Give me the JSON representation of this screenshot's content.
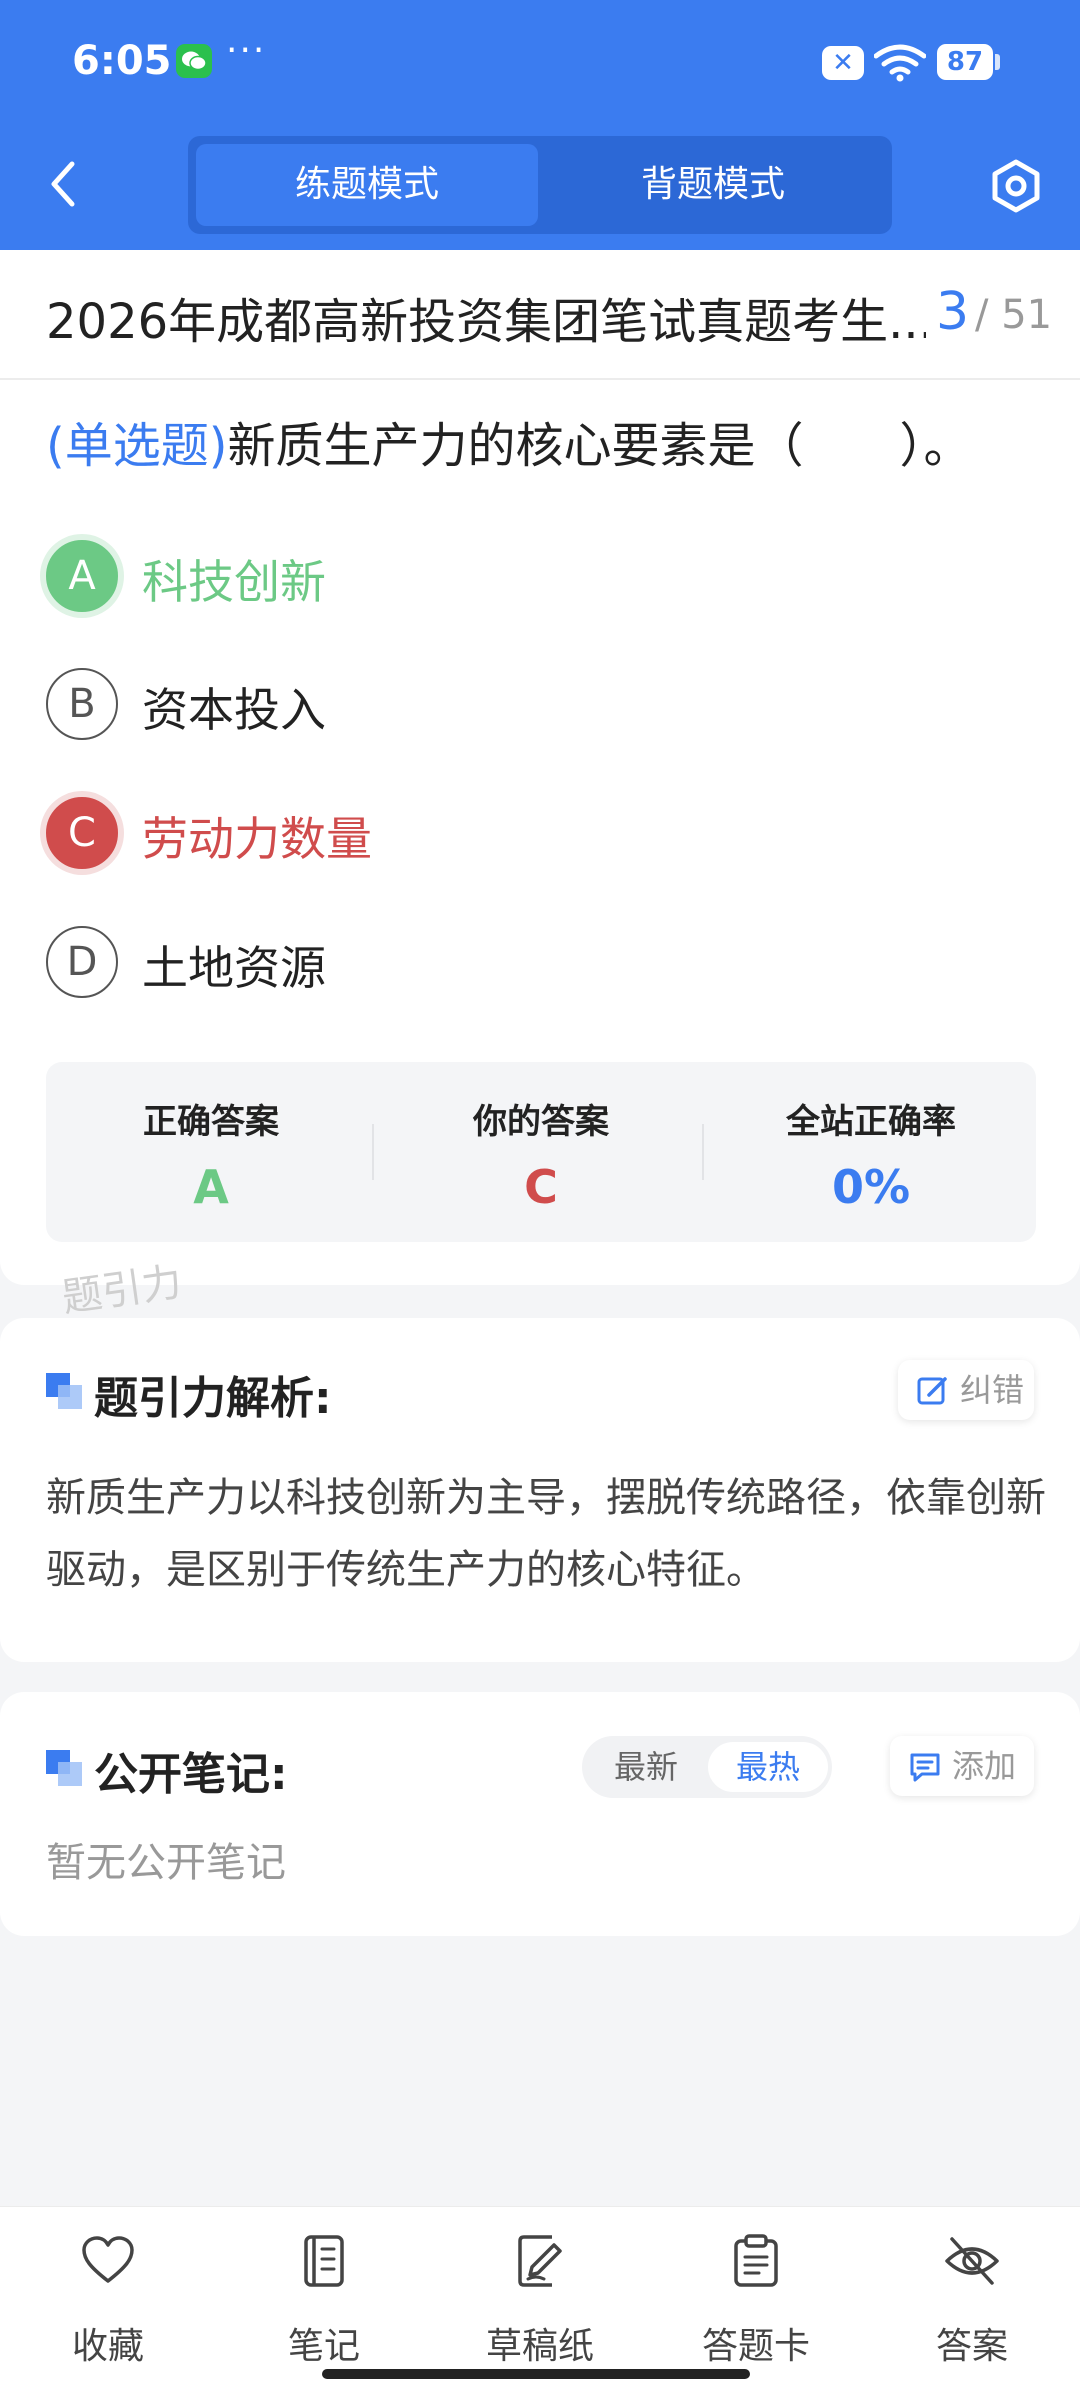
{
  "status_bar": {
    "time": "6:05",
    "more": "···",
    "battery": "87",
    "icons": [
      "wechat-icon",
      "close-badge-icon",
      "wifi-icon",
      "battery-icon"
    ]
  },
  "header": {
    "modes": [
      {
        "label": "练题模式",
        "active": true
      },
      {
        "label": "背题模式",
        "active": false
      }
    ],
    "icons": [
      "back-icon",
      "settings-icon"
    ]
  },
  "exam": {
    "title": "2026年成都高新投资集团笔试真题考生...",
    "progress_current": "3",
    "progress_total": "/ 51"
  },
  "question": {
    "type": "(单选题)",
    "text": "新质生产力的核心要素是（　　）。",
    "options": [
      {
        "letter": "A",
        "text": "科技创新",
        "state": "correct"
      },
      {
        "letter": "B",
        "text": "资本投入",
        "state": "normal"
      },
      {
        "letter": "C",
        "text": "劳动力数量",
        "state": "wrong"
      },
      {
        "letter": "D",
        "text": "土地资源",
        "state": "normal"
      }
    ]
  },
  "result": {
    "correct_label": "正确答案",
    "correct_value": "A",
    "yours_label": "你的答案",
    "yours_value": "C",
    "rate_label": "全站正确率",
    "rate_value": "0%"
  },
  "watermark": "题引力",
  "analysis": {
    "title": "题引力解析:",
    "report_button": "纠错",
    "text": "新质生产力以科技创新为主导，摆脱传统路径，依靠创新驱动，是区别于传统生产力的核心特征。"
  },
  "notes": {
    "title": "公开笔记:",
    "sort_latest": "最新",
    "sort_hot": "最热",
    "add_button": "添加",
    "empty_text": "暂无公开笔记"
  },
  "bottom_nav": [
    {
      "label": "收藏",
      "icon": "heart-icon"
    },
    {
      "label": "笔记",
      "icon": "notebook-icon"
    },
    {
      "label": "草稿纸",
      "icon": "draft-icon"
    },
    {
      "label": "答题卡",
      "icon": "answer-sheet-icon"
    },
    {
      "label": "答案",
      "icon": "eye-off-icon"
    }
  ],
  "colors": {
    "primary": "#3b7cf0",
    "correct": "#6cc985",
    "wrong": "#d04c4c",
    "muted": "#999999"
  }
}
